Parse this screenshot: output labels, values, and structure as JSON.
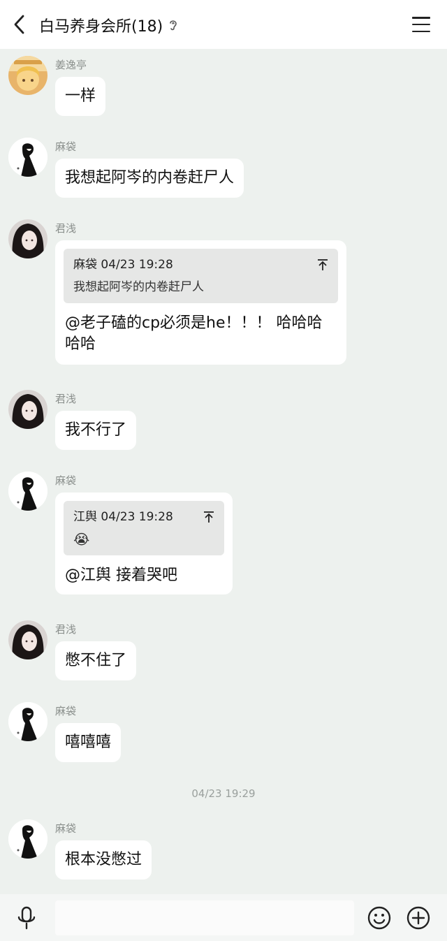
{
  "header": {
    "title": "白马养身会所(18)"
  },
  "messages": [
    {
      "sender": "姜逸亭",
      "text": "一样",
      "avatar": "avatar-jiangyiting"
    },
    {
      "sender": "麻袋",
      "text": "我想起阿岑的内卷赶尸人",
      "avatar": "avatar-madai"
    },
    {
      "sender": "君浅",
      "avatar": "avatar-junqian",
      "quote": {
        "author_time": "麻袋 04/23 19:28",
        "text": "我想起阿岑的内卷赶尸人"
      },
      "text_line1": "@老子磕的cp必须是he！！！ 哈哈哈",
      "text_line2": "哈哈"
    },
    {
      "sender": "君浅",
      "text": "我不行了",
      "avatar": "avatar-junqian"
    },
    {
      "sender": "麻袋",
      "avatar": "avatar-madai",
      "quote": {
        "author_time": "江舆 04/23 19:28",
        "emoji": "😭"
      },
      "text": "@江舆 接着哭吧"
    },
    {
      "sender": "君浅",
      "text": "憋不住了",
      "avatar": "avatar-junqian"
    },
    {
      "sender": "麻袋",
      "text": "嘻嘻嘻",
      "avatar": "avatar-madai"
    },
    {
      "sender": "麻袋",
      "text": "根本没憋过",
      "avatar": "avatar-madai"
    }
  ],
  "timestamp": "04/23 19:29",
  "input": {
    "placeholder": ""
  },
  "colors": {
    "background": "#edf1ee",
    "bubble": "#ffffff",
    "quote": "#e6e7e6",
    "sender": "#8a8f8c"
  },
  "icons": {
    "back": "chevron-left-icon",
    "ear": "ear-icon",
    "menu": "menu-icon",
    "quote_up": "arrow-to-top-icon",
    "mic": "microphone-icon",
    "emoji": "smiley-icon",
    "plus": "plus-circle-icon"
  }
}
